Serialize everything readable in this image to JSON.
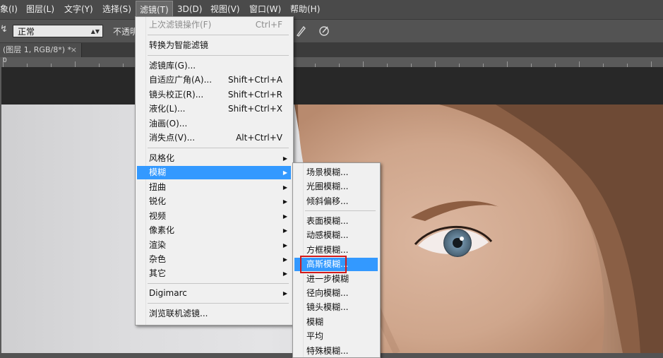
{
  "menubar": {
    "items": [
      "象(I)",
      "图层(L)",
      "文字(Y)",
      "选择(S)",
      "滤镜(T)",
      "3D(D)",
      "视图(V)",
      "窗口(W)",
      "帮助(H)"
    ],
    "active": "滤镜(T)"
  },
  "options": {
    "tool_glyph": "↯",
    "blend_mode": "正常",
    "opacity_label": "不透明"
  },
  "document_tab": {
    "title": "(图层 1, RGB/8*) *",
    "close": "×"
  },
  "ruler": {
    "zero_label": "0"
  },
  "filter_menu": {
    "items": [
      {
        "label": "上次滤镜操作(F)",
        "shortcut": "Ctrl+F"
      },
      {
        "label": "转换为智能滤镜"
      },
      {
        "label": "滤镜库(G)..."
      },
      {
        "label": "自适应广角(A)...",
        "shortcut": "Shift+Ctrl+A"
      },
      {
        "label": "镜头校正(R)...",
        "shortcut": "Shift+Ctrl+R"
      },
      {
        "label": "液化(L)...",
        "shortcut": "Shift+Ctrl+X"
      },
      {
        "label": "油画(O)..."
      },
      {
        "label": "消失点(V)...",
        "shortcut": "Alt+Ctrl+V"
      },
      {
        "label": "风格化"
      },
      {
        "label": "模糊"
      },
      {
        "label": "扭曲"
      },
      {
        "label": "锐化"
      },
      {
        "label": "视频"
      },
      {
        "label": "像素化"
      },
      {
        "label": "渲染"
      },
      {
        "label": "杂色"
      },
      {
        "label": "其它"
      },
      {
        "label": "Digimarc"
      },
      {
        "label": "浏览联机滤镜..."
      }
    ],
    "submenu_arrow": "▶"
  },
  "blur_menu": {
    "items": [
      "场景模糊...",
      "光圈模糊...",
      "倾斜偏移...",
      "表面模糊...",
      "动感模糊...",
      "方框模糊...",
      "高斯模糊...",
      "进一步模糊",
      "径向模糊...",
      "镜头模糊...",
      "模糊",
      "平均",
      "特殊模糊..."
    ],
    "highlighted": "高斯模糊..."
  },
  "colors": {
    "highlight": "#3399ff",
    "callout": "#d21a1a",
    "menu_bg": "#f0f0f0",
    "chrome": "#535353"
  }
}
